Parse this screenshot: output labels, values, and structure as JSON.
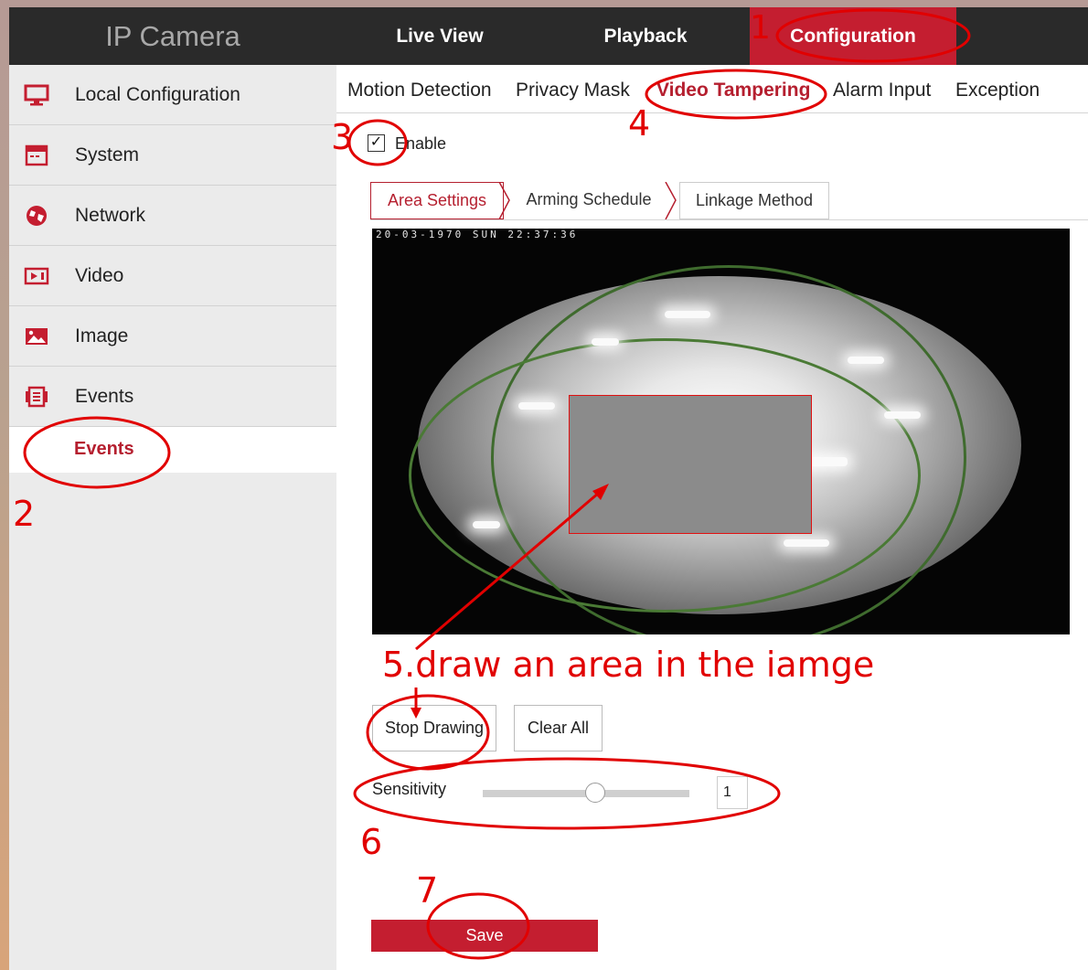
{
  "header": {
    "brand": "IP Camera",
    "nav": [
      {
        "label": "Live View"
      },
      {
        "label": "Playback"
      },
      {
        "label": "Configuration"
      }
    ]
  },
  "sidebar": {
    "items": [
      {
        "label": "Local Configuration",
        "icon": "monitor-icon"
      },
      {
        "label": "System",
        "icon": "window-icon"
      },
      {
        "label": "Network",
        "icon": "globe-icon"
      },
      {
        "label": "Video",
        "icon": "video-icon"
      },
      {
        "label": "Image",
        "icon": "image-icon"
      },
      {
        "label": "Events",
        "icon": "events-icon"
      }
    ],
    "sub_item": "Events"
  },
  "main": {
    "tabs": [
      "Motion Detection",
      "Privacy Mask",
      "Video Tampering",
      "Alarm Input",
      "Exception"
    ],
    "active_tab": "Video Tampering",
    "enable_label": "Enable",
    "enable_checked": true,
    "steps": [
      "Area Settings",
      "Arming Schedule",
      "Linkage Method"
    ],
    "video_osd": "20-03-1970 SUN 22:37:36",
    "buttons": {
      "stop_drawing": "Stop Drawing",
      "clear_all": "Clear All",
      "save": "Save"
    },
    "sensitivity_label": "Sensitivity",
    "sensitivity_value": "1",
    "sensitivity_fraction": 0.55
  },
  "annotations": {
    "n1": "1",
    "n2": "2",
    "n3": "3",
    "n4": "4",
    "n5": "5.draw an area in the iamge",
    "n6": "6",
    "n7": "7"
  },
  "colors": {
    "accent": "#c41e30",
    "annotation": "#e10000",
    "topbar": "#2a2a2a",
    "sidebar": "#ebebeb"
  }
}
